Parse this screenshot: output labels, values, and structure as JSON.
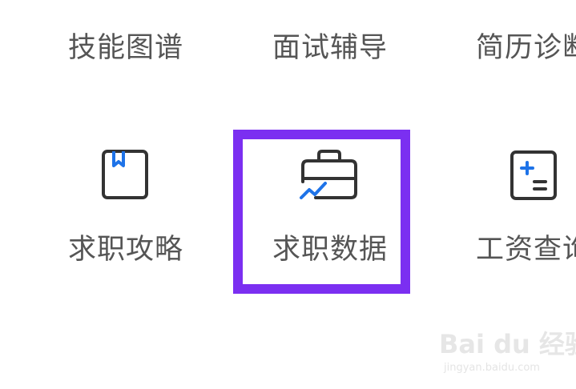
{
  "colors": {
    "label_text": "#555555",
    "icon_stroke": "#333333",
    "icon_accent": "#1e73e8",
    "highlight_border": "#7b2ff1"
  },
  "grid": {
    "row1": [
      {
        "label": "技能图谱"
      },
      {
        "label": "面试辅导"
      },
      {
        "label": "简历诊断"
      }
    ],
    "row2": [
      {
        "label": "求职攻略",
        "icon": "bookmark-book-icon"
      },
      {
        "label": "求职数据",
        "icon": "briefcase-chart-icon"
      },
      {
        "label": "工资查询",
        "icon": "calculator-icon"
      }
    ]
  },
  "watermark": {
    "brand": "Bai du 经验",
    "url": "jingyan.baidu.com"
  }
}
